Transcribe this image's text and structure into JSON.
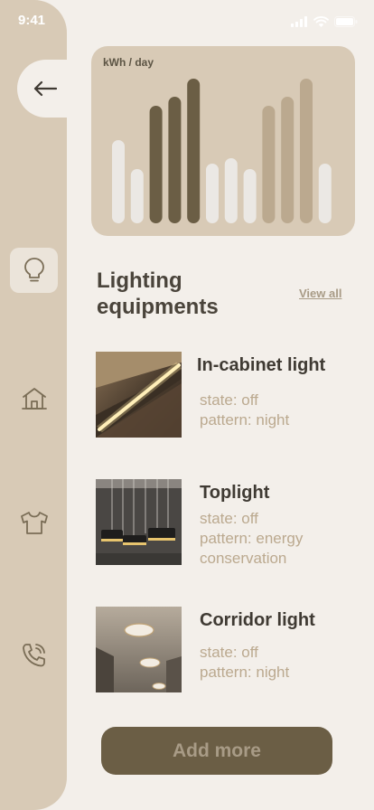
{
  "status": {
    "time": "9:41"
  },
  "sidebar": {
    "items": [
      {
        "icon": "lightbulb-icon",
        "active": true
      },
      {
        "icon": "home-icon",
        "active": false
      },
      {
        "icon": "tshirt-icon",
        "active": false
      },
      {
        "icon": "phone-icon",
        "active": false
      }
    ]
  },
  "chart_data": {
    "type": "bar",
    "ylabel": "kWh / day",
    "values": [
      92,
      60,
      130,
      140,
      160,
      66,
      72,
      60,
      130,
      140,
      160,
      66
    ],
    "colors": [
      "#ebe8e4",
      "#ebe8e4",
      "#6b5e45",
      "#6b5e45",
      "#6b5e45",
      "#ebe8e4",
      "#ebe8e4",
      "#ebe8e4",
      "#bba98f",
      "#bba98f",
      "#bba98f",
      "#ebe8e4"
    ]
  },
  "section": {
    "title": "Lighting equipments",
    "view_all": "View all"
  },
  "equipment": [
    {
      "name": "In-cabinet light",
      "state": "state: off",
      "pattern": "pattern: night"
    },
    {
      "name": "Toplight",
      "state": "state: off",
      "pattern": "pattern: energy conservation"
    },
    {
      "name": "Corridor light",
      "state": "state: off",
      "pattern": "pattern: night"
    }
  ],
  "actions": {
    "add_more": "Add more"
  },
  "theme": {
    "background": "#f3efea",
    "sidebar": "#d8cab6",
    "accent_dark": "#6b5e45",
    "muted_text": "#bba98f"
  }
}
